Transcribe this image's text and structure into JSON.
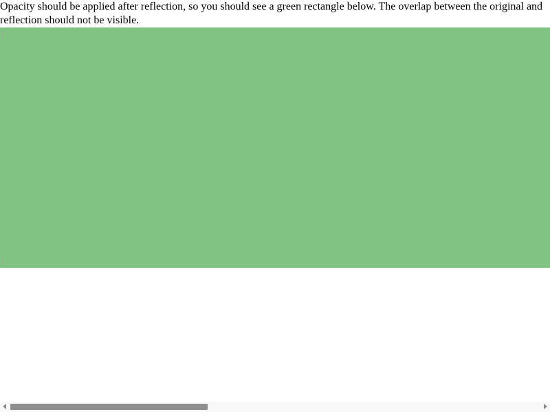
{
  "instruction": {
    "text": "Opacity should be applied after reflection, so you should see a green rectangle below. The overlap between the original and reflection should not be visible."
  },
  "rectangle": {
    "color": "#80c383",
    "top_glyph": "]",
    "bottom_glyph": "]"
  },
  "scrollbar": {
    "left_arrow": "scroll-left-arrow-icon",
    "right_arrow": "scroll-right-arrow-icon",
    "thumb_color": "#8f8f8f"
  }
}
